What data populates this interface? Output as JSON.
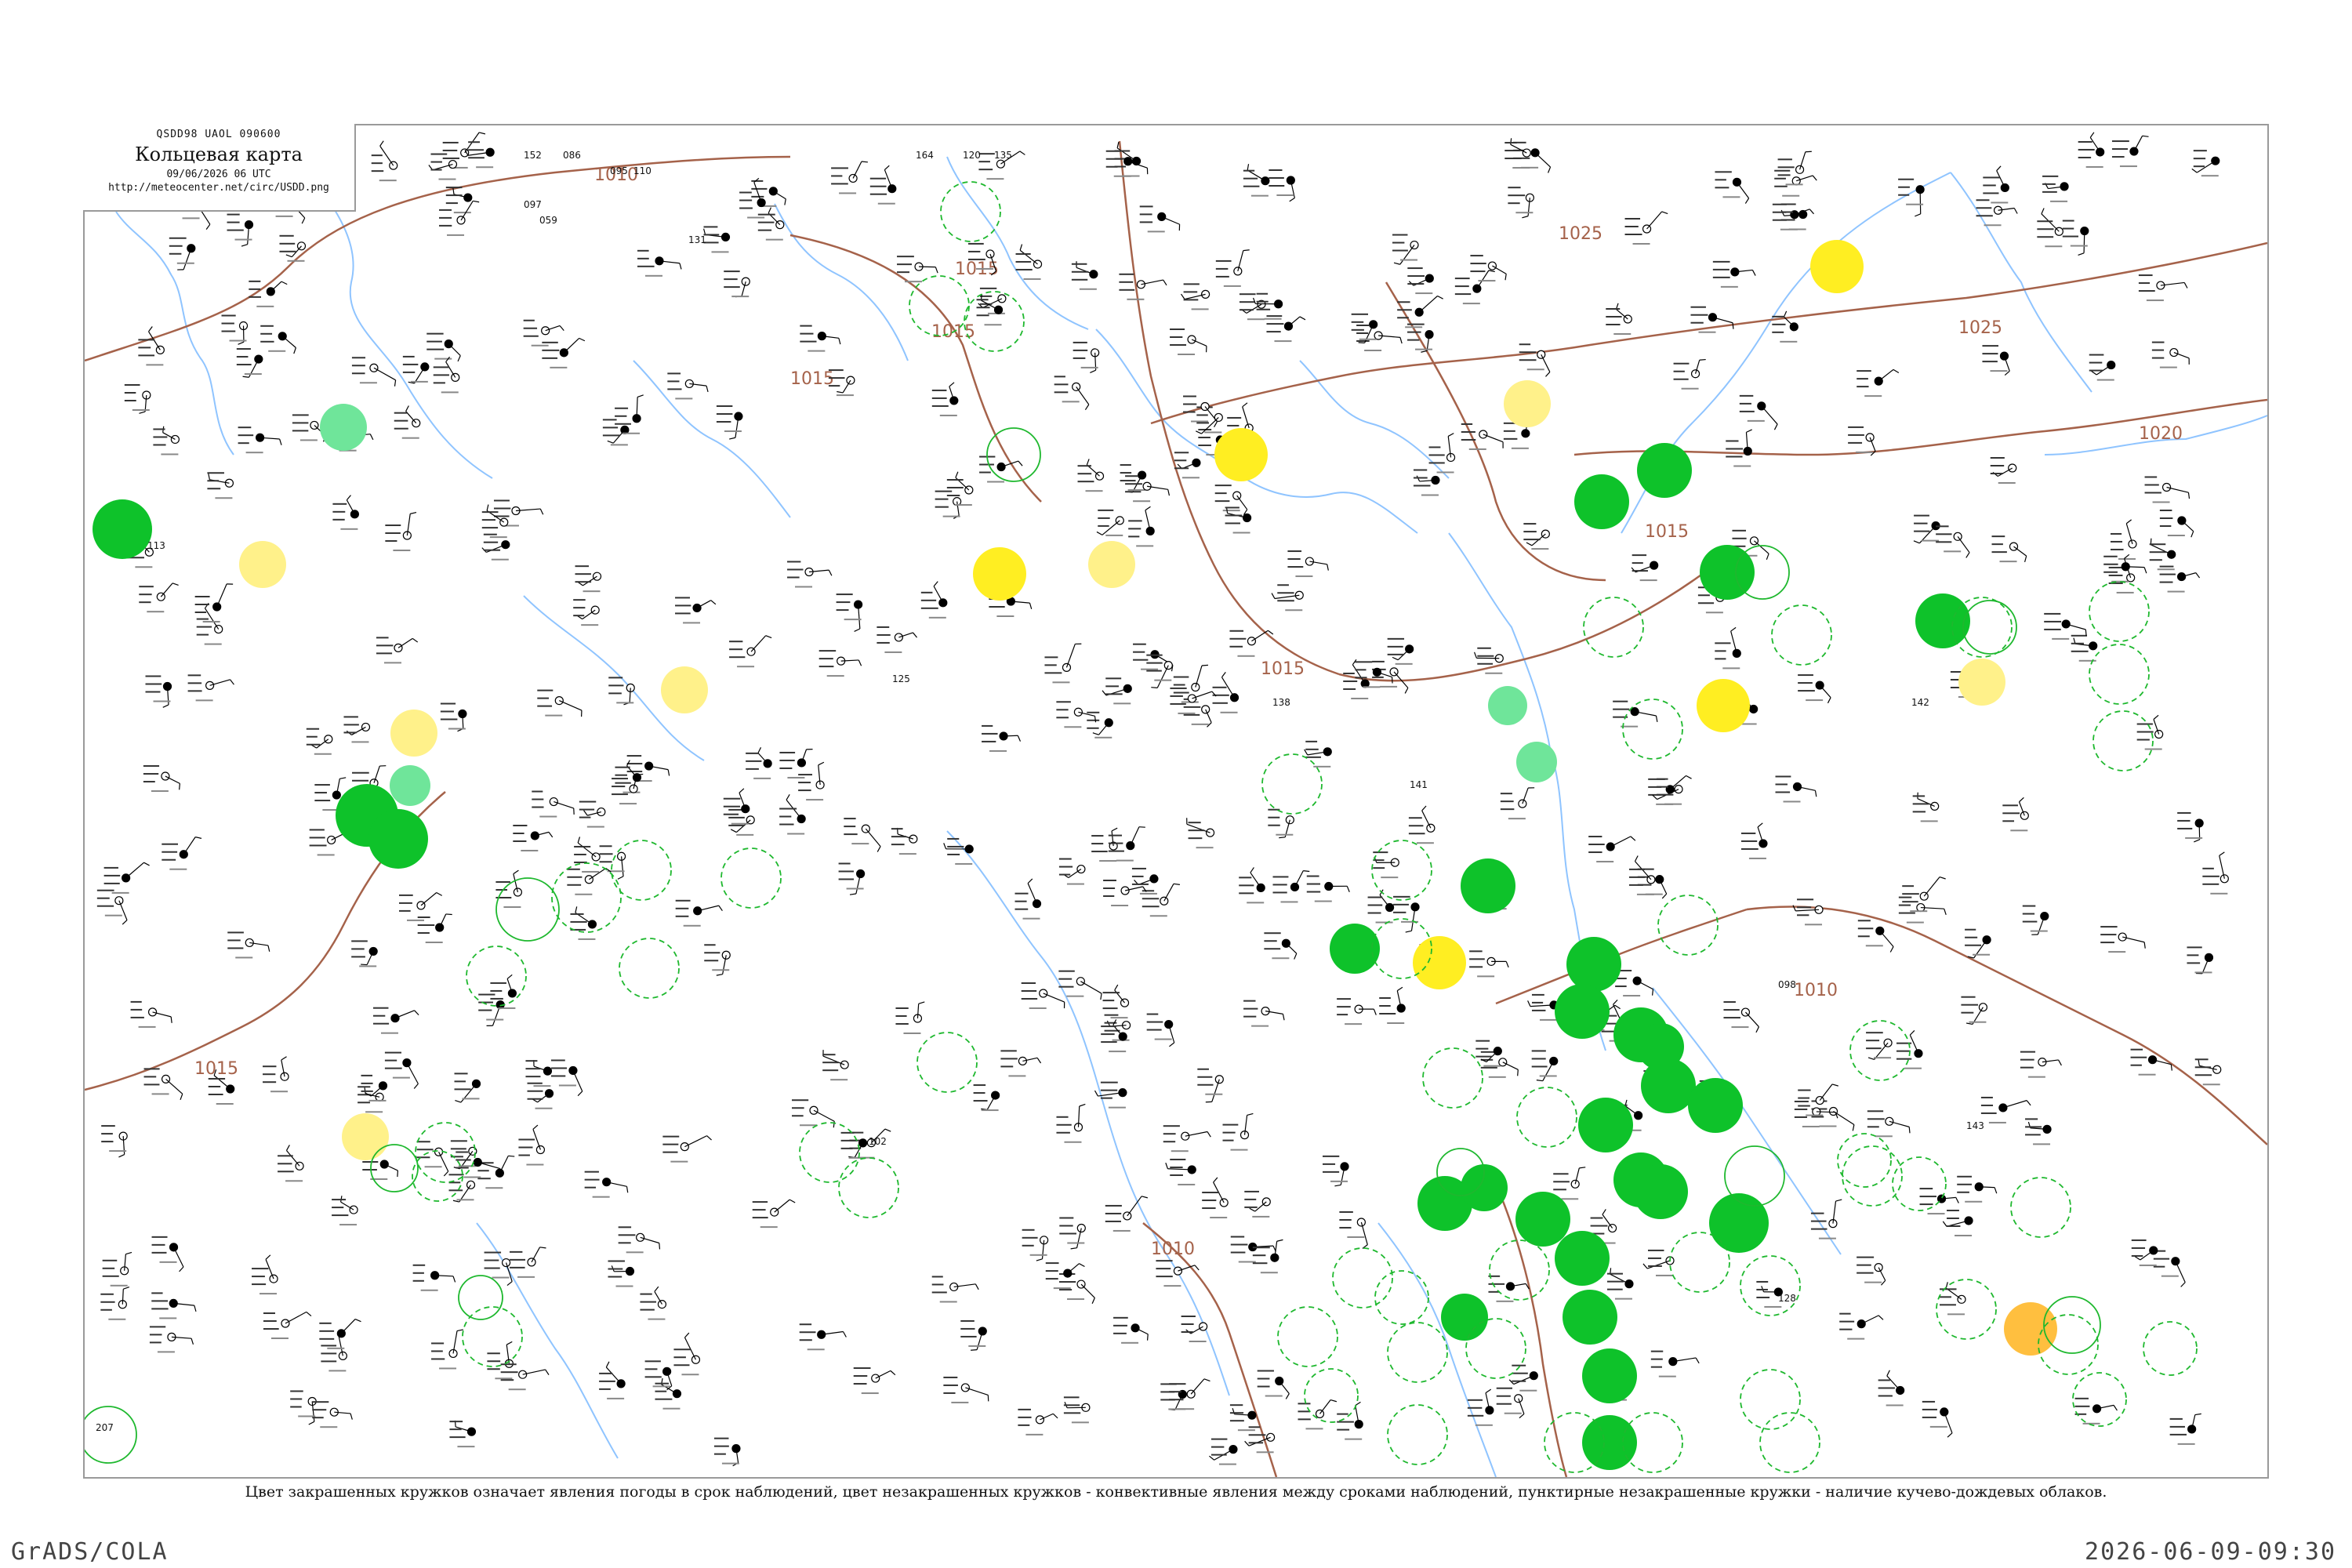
{
  "header": {
    "codes": "QSDD98  UAOL  090600",
    "title": "Кольцевая карта",
    "datetime": "09/06/2026 06 UTC",
    "url": "http://meteocenter.net/circ/USDD.png"
  },
  "caption": "Цвет закрашенных кружков означает явления погоды в срок наблюдений, цвет незакрашенных кружков - конвективные явления между сроками наблюдений, пунктирные незакрашенные кружки - наличие кучево-дождевых облаков.",
  "footer": {
    "software": "GrADS/COLA",
    "timestamp": "2026-06-09-09:30"
  },
  "isobar_labels": [
    "1010",
    "1015",
    "1015",
    "1015",
    "1015",
    "1015",
    "1010",
    "1020",
    "1025",
    "1025",
    "1015",
    "1010",
    "1010"
  ],
  "sample_station_values": [
    "152",
    "086",
    "095",
    "110",
    "097",
    "059",
    "164",
    "120",
    "135",
    "141",
    "125",
    "138",
    "131",
    "142",
    "143",
    "128",
    "113",
    "102",
    "098",
    "207"
  ],
  "colors": {
    "frame": "#9a9a9a",
    "isobar": "#a5624a",
    "river": "#7ab8ff",
    "rain_fill": "#0ec22a",
    "light_fill": "#6fe59a",
    "fog_fill": "#ffee22",
    "haze_fill": "#fff18a",
    "storm_fill": "#ffbf3f",
    "cb_ring": "#1eb82e",
    "station": "#000000"
  }
}
